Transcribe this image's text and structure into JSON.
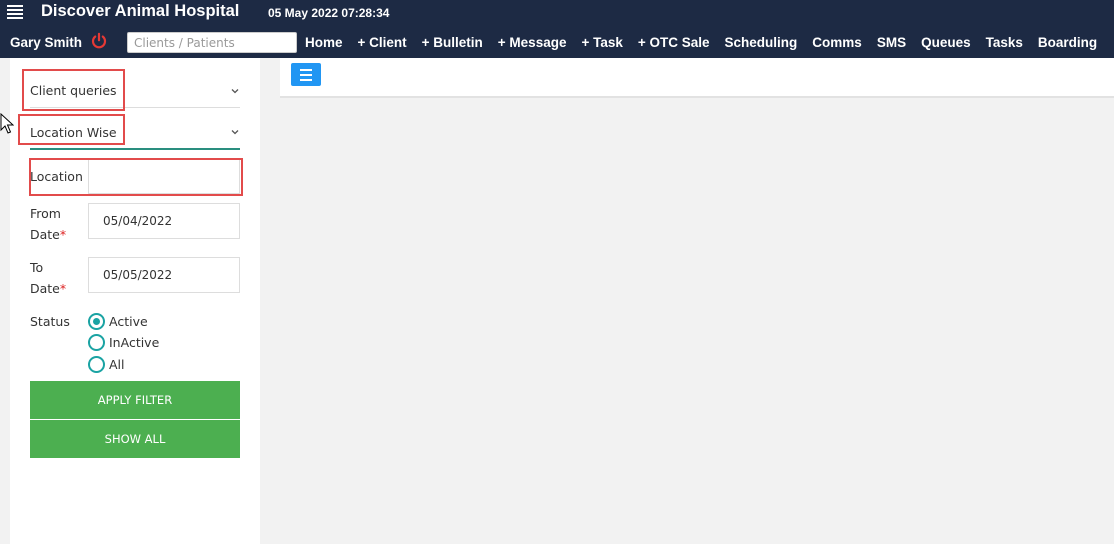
{
  "header": {
    "app_title": "Discover Animal Hospital",
    "datetime": "05 May 2022 07:28:34",
    "user_name": "Gary Smith",
    "search_placeholder": "Clients / Patients",
    "nav": [
      "Home",
      "+ Client",
      "+ Bulletin",
      "+ Message",
      "+ Task",
      "+ OTC Sale",
      "Scheduling",
      "Comms",
      "SMS",
      "Queues",
      "Tasks",
      "Boarding"
    ]
  },
  "sidebar": {
    "query_type": "Client queries",
    "report_type": "Location Wise",
    "location_label": "Location",
    "location_value": "",
    "from_date_label_1": "From",
    "from_date_label_2": "Date",
    "from_date_value": "05/04/2022",
    "to_date_label_1": "To",
    "to_date_label_2": "Date",
    "to_date_value": "05/05/2022",
    "required_mark": "*",
    "status_label": "Status",
    "status_options": [
      "Active",
      "InActive",
      "All"
    ],
    "status_selected": "Active",
    "apply_button": "APPLY FILTER",
    "show_all_button": "SHOW ALL"
  },
  "colors": {
    "header_bg": "#1d2a44",
    "accent_green": "#4caf50",
    "radio_teal": "#1aa3a3",
    "power_red": "#e53935",
    "highlight_red": "#e24b4b",
    "menu_blue": "#2196f3"
  }
}
